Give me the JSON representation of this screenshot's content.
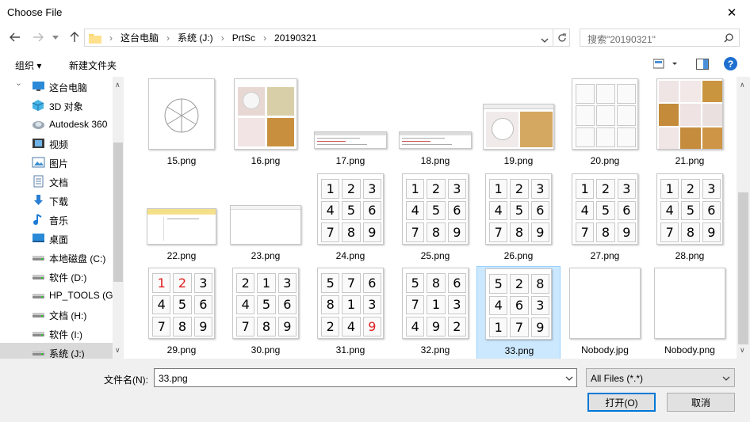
{
  "window": {
    "title": "Choose File",
    "close_glyph": "✕"
  },
  "address": {
    "segments": [
      "这台电脑",
      "系统 (J:)",
      "PrtSc",
      "20190321"
    ]
  },
  "search": {
    "placeholder": "搜索\"20190321\""
  },
  "toolbar": {
    "organize": "组织 ▾",
    "new_folder": "新建文件夹"
  },
  "nav": {
    "items": [
      {
        "label": "这台电脑",
        "icon": "computer-icon"
      },
      {
        "label": "3D 对象",
        "icon": "3d-objects-icon"
      },
      {
        "label": "Autodesk 360",
        "icon": "cloud-icon"
      },
      {
        "label": "视频",
        "icon": "video-icon"
      },
      {
        "label": "图片",
        "icon": "pictures-icon"
      },
      {
        "label": "文档",
        "icon": "documents-icon"
      },
      {
        "label": "下载",
        "icon": "download-icon"
      },
      {
        "label": "音乐",
        "icon": "music-icon"
      },
      {
        "label": "桌面",
        "icon": "desktop-icon"
      },
      {
        "label": "本地磁盘 (C:)",
        "icon": "drive-icon"
      },
      {
        "label": "软件 (D:)",
        "icon": "drive-icon"
      },
      {
        "label": "HP_TOOLS (G:)",
        "icon": "drive-icon"
      },
      {
        "label": "文档 (H:)",
        "icon": "drive-icon"
      },
      {
        "label": "软件 (I:)",
        "icon": "drive-icon"
      },
      {
        "label": "系统 (J:)",
        "icon": "drive-icon"
      }
    ]
  },
  "files": [
    {
      "name": "15.png",
      "kind": "wheel"
    },
    {
      "name": "16.png",
      "kind": "photos2x2"
    },
    {
      "name": "17.png",
      "kind": "screenshot"
    },
    {
      "name": "18.png",
      "kind": "screenshot"
    },
    {
      "name": "19.png",
      "kind": "photos1x2"
    },
    {
      "name": "20.png",
      "kind": "blank9"
    },
    {
      "name": "21.png",
      "kind": "photos3x3"
    },
    {
      "name": "22.png",
      "kind": "explorer"
    },
    {
      "name": "23.png",
      "kind": "emptywin"
    },
    {
      "name": "24.png",
      "kind": "grid",
      "cells": [
        "1",
        "2",
        "3",
        "4",
        "5",
        "6",
        "7",
        "8",
        "9"
      ]
    },
    {
      "name": "25.png",
      "kind": "grid",
      "cells": [
        "1",
        "2",
        "3",
        "4",
        "5",
        "6",
        "7",
        "8",
        "9"
      ]
    },
    {
      "name": "26.png",
      "kind": "grid",
      "cells": [
        "1",
        "2",
        "3",
        "4",
        "5",
        "6",
        "7",
        "8",
        "9"
      ]
    },
    {
      "name": "27.png",
      "kind": "grid",
      "cells": [
        "1",
        "2",
        "3",
        "4",
        "5",
        "6",
        "7",
        "8",
        "9"
      ]
    },
    {
      "name": "28.png",
      "kind": "grid",
      "cells": [
        "1",
        "2",
        "3",
        "4",
        "5",
        "6",
        "7",
        "8",
        "9"
      ]
    },
    {
      "name": "29.png",
      "kind": "grid",
      "cells": [
        "1",
        "2",
        "3",
        "4",
        "5",
        "6",
        "7",
        "8",
        "9"
      ],
      "red": [
        0,
        1
      ]
    },
    {
      "name": "30.png",
      "kind": "grid",
      "cells": [
        "2",
        "1",
        "3",
        "4",
        "5",
        "6",
        "7",
        "8",
        "9"
      ]
    },
    {
      "name": "31.png",
      "kind": "grid",
      "cells": [
        "5",
        "7",
        "6",
        "8",
        "1",
        "3",
        "2",
        "4",
        "9"
      ],
      "red": [
        8
      ]
    },
    {
      "name": "32.png",
      "kind": "grid",
      "cells": [
        "5",
        "8",
        "6",
        "7",
        "1",
        "3",
        "4",
        "9",
        "2"
      ]
    },
    {
      "name": "33.png",
      "kind": "grid",
      "cells": [
        "5",
        "2",
        "8",
        "4",
        "6",
        "3",
        "1",
        "7",
        "9"
      ],
      "selected": true
    },
    {
      "name": "Nobody.jpg",
      "kind": "white"
    },
    {
      "name": "Nobody.png",
      "kind": "white"
    }
  ],
  "bottom": {
    "filename_label": "文件名(N):",
    "filename_value": "33.png",
    "filter_value": "All Files (*.*)",
    "open_label": "打开(O)",
    "cancel_label": "取消"
  },
  "colors": {
    "accent": "#0078d7",
    "selection": "#cce8ff",
    "red_digit": "#e02020"
  }
}
